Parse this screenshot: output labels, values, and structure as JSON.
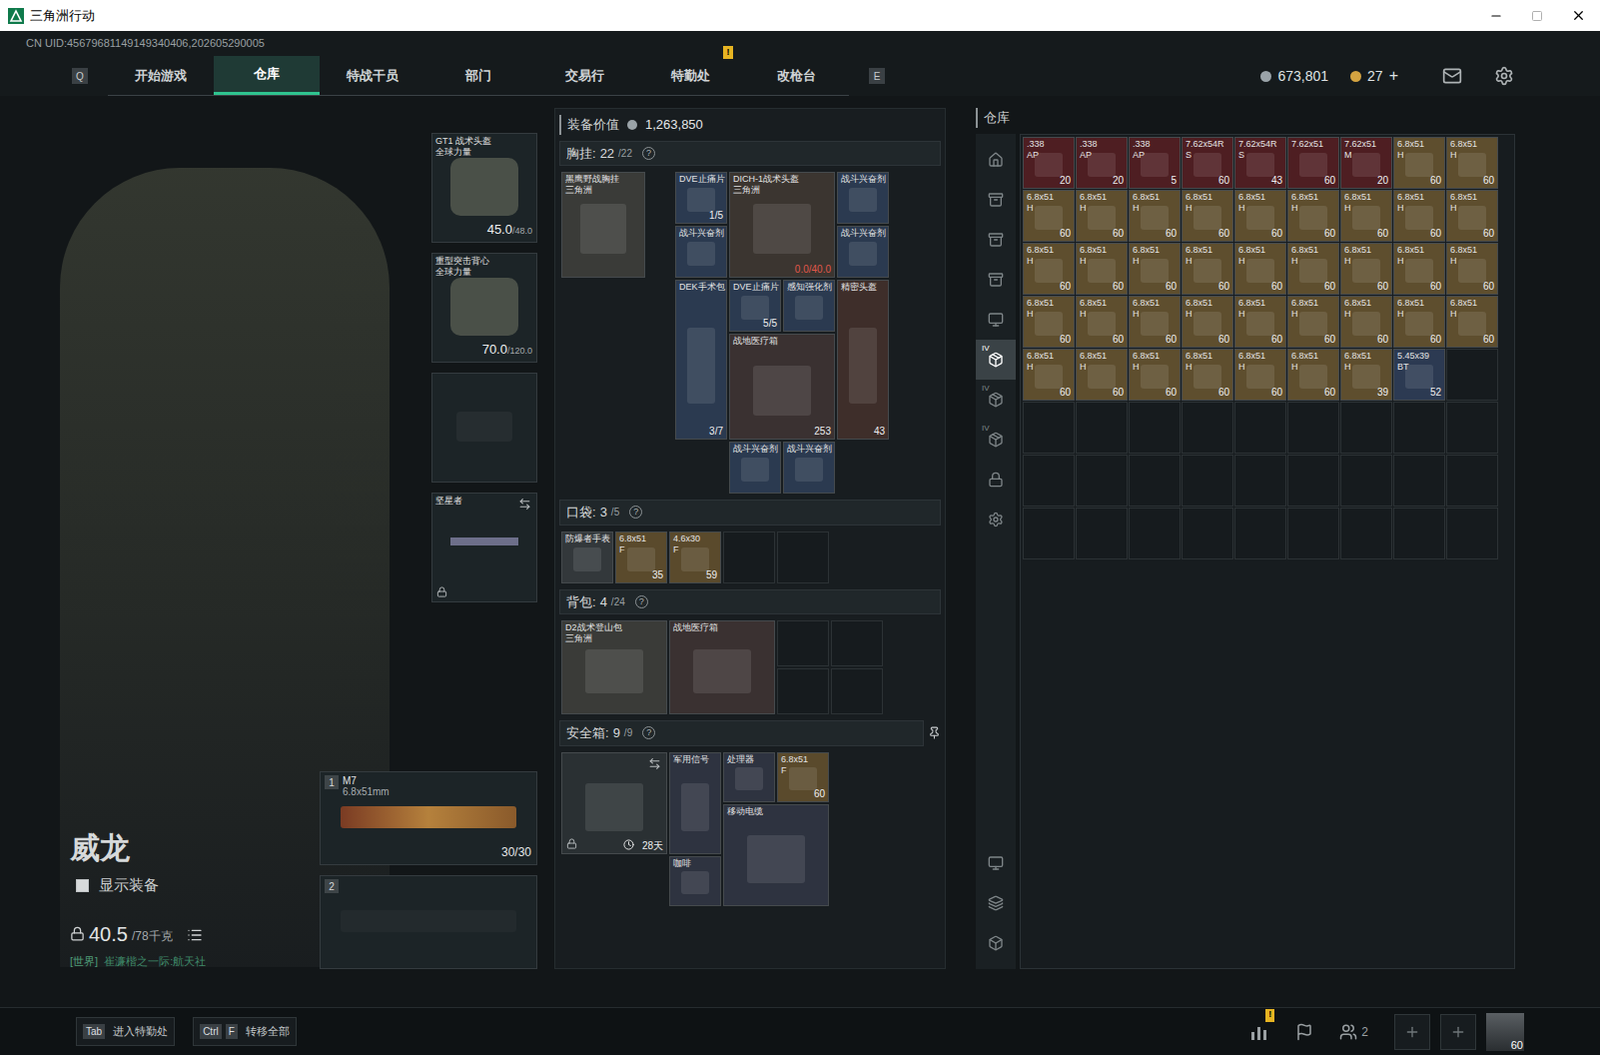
{
  "window": {
    "title": "三角洲行动"
  },
  "uid": "CN UID:45679681149149340406,202605290005",
  "nav": {
    "prev_key": "Q",
    "next_key": "E",
    "alert_badge": "!",
    "tabs": [
      {
        "label": "开始游戏",
        "selected": false,
        "alert": false
      },
      {
        "label": "仓库",
        "selected": true,
        "alert": false
      },
      {
        "label": "特战干员",
        "selected": false,
        "alert": false
      },
      {
        "label": "部门",
        "selected": false,
        "alert": false
      },
      {
        "label": "交易行",
        "selected": false,
        "alert": false
      },
      {
        "label": "特勤处",
        "selected": false,
        "alert": true
      },
      {
        "label": "改枪台",
        "selected": false,
        "alert": false
      }
    ]
  },
  "currency": {
    "coins": "673,801",
    "tokens": "27",
    "add": "+"
  },
  "operator": {
    "name": "威龙",
    "show_equipment": {
      "label": "显示装备",
      "checked": false
    },
    "weight": "40.5",
    "weight_max": "/78千克",
    "chat": {
      "channel": "[世界]",
      "text": "崔濂楷之一际:航天社"
    }
  },
  "gear_slots": [
    {
      "kind": "helmet",
      "name": "GT1 战术头盔",
      "sub": "全球力量",
      "value": "45.0",
      "max": "/48.0",
      "locked": false
    },
    {
      "kind": "armor",
      "name": "重型突击背心",
      "sub": "全球力量",
      "value": "70.0",
      "max": "/120.0",
      "locked": false
    },
    {
      "kind": "empty",
      "name": "",
      "sub": "",
      "value": "",
      "max": "",
      "locked": false
    },
    {
      "kind": "melee",
      "name": "坚星者",
      "sub": "",
      "value": "",
      "max": "",
      "locked": true
    }
  ],
  "weapons": [
    {
      "slot": "1",
      "name": "M7",
      "caliber": "6.8x51mm",
      "ammo": "30/30",
      "empty": false
    },
    {
      "slot": "2",
      "name": "",
      "caliber": "",
      "ammo": "",
      "empty": true
    }
  ],
  "loadout": {
    "value_label": "装备价值",
    "value": "1,263,850",
    "chest": {
      "label": "胸挂:",
      "count": "22",
      "capacity": "/22",
      "help": "?",
      "items": [
        {
          "name": "黑鹰野战胸挂",
          "sub": "三角洲",
          "value": "",
          "broken": false,
          "color": "#3a3b38"
        },
        {
          "name": "DVE止痛片",
          "sub": "",
          "value": "1/5",
          "broken": false,
          "color": "#2b3a50"
        },
        {
          "name": "DICH-1战术头盔",
          "sub": "三角洲",
          "value": "0.0/40.0",
          "broken": true,
          "color": "#3b3530"
        },
        {
          "name": "战斗兴奋剂",
          "sub": "",
          "value": "",
          "broken": false,
          "color": "#2b3a50"
        },
        {
          "name": "战斗兴奋剂",
          "sub": "",
          "value": "",
          "broken": false,
          "color": "#2b3a50"
        },
        {
          "name": "战斗兴奋剂",
          "sub": "",
          "value": "",
          "broken": false,
          "color": "#2b3a50"
        },
        {
          "name": "DEK手术包",
          "sub": "",
          "value": "3/7",
          "broken": false,
          "color": "#2b3a50"
        },
        {
          "name": "DVE止痛片",
          "sub": "",
          "value": "5/5",
          "broken": false,
          "color": "#2b3a50"
        },
        {
          "name": "感知强化剂",
          "sub": "",
          "value": "",
          "broken": false,
          "color": "#2b3a50"
        },
        {
          "name": "精密头盔",
          "sub": "",
          "value": "43",
          "broken": false,
          "color": "#3e2e2a"
        },
        {
          "name": "战地医疗箱",
          "sub": "",
          "value": "253",
          "broken": false,
          "color": "#3a3131"
        },
        {
          "name": "战斗兴奋剂",
          "sub": "",
          "value": "",
          "broken": false,
          "color": "#2b3a50"
        },
        {
          "name": "战斗兴奋剂",
          "sub": "",
          "value": "",
          "broken": false,
          "color": "#2b3a50"
        }
      ]
    },
    "pockets": {
      "label": "口袋:",
      "count": "3",
      "capacity": "/5",
      "help": "?",
      "empty_slots": 2,
      "items": [
        {
          "name": "防爆者手表",
          "sub": "",
          "value": "",
          "broken": false,
          "color": "#33383b"
        },
        {
          "name": "6.8x51",
          "sub": "F",
          "value": "35",
          "broken": false,
          "color": "#5a4a2c"
        },
        {
          "name": "4.6x30",
          "sub": "F",
          "value": "59",
          "broken": false,
          "color": "#5a4a2c"
        }
      ]
    },
    "backpack": {
      "label": "背包:",
      "count": "4",
      "capacity": "/24",
      "help": "?",
      "empty_slots": 4,
      "items": [
        {
          "name": "D2战术登山包",
          "sub": "三角洲",
          "value": "",
          "broken": false,
          "color": "#3a3b38"
        },
        {
          "name": "战地医疗箱",
          "sub": "",
          "value": "",
          "broken": false,
          "color": "#3a3131"
        }
      ]
    },
    "safe": {
      "label": "安全箱:",
      "count": "9",
      "capacity": "/9",
      "help": "?",
      "items": [
        {
          "name": "",
          "sub": "",
          "value": "28天",
          "broken": false,
          "color": "#2a3033"
        },
        {
          "name": "军用信号",
          "sub": "",
          "value": "",
          "broken": false,
          "color": "#2e3340"
        },
        {
          "name": "处理器",
          "sub": "",
          "value": "",
          "broken": false,
          "color": "#2e3340"
        },
        {
          "name": "6.8x51",
          "sub": "F",
          "value": "60",
          "broken": false,
          "color": "#5a4a2c"
        },
        {
          "name": "移动电缆",
          "sub": "",
          "value": "",
          "broken": false,
          "color": "#2e3340"
        },
        {
          "name": "咖啡",
          "sub": "",
          "value": "",
          "broken": false,
          "color": "#2e3340"
        }
      ]
    }
  },
  "warehouse": {
    "label": "仓库",
    "tabs": [
      {
        "badge": "",
        "selected": false
      },
      {
        "badge": "",
        "selected": false
      },
      {
        "badge": "",
        "selected": false
      },
      {
        "badge": "",
        "selected": false
      },
      {
        "badge": "",
        "selected": false
      },
      {
        "badge": "IV",
        "selected": true
      },
      {
        "badge": "IV",
        "selected": false
      },
      {
        "badge": "IV",
        "selected": false
      },
      {
        "badge": "",
        "selected": false
      },
      {
        "badge": "",
        "selected": false
      }
    ],
    "empty_cells": 28,
    "items": [
      {
        "name": ".338",
        "sub": "AP",
        "value": "20",
        "color": "#4e1e22"
      },
      {
        "name": ".338",
        "sub": "AP",
        "value": "20",
        "color": "#4e1e22"
      },
      {
        "name": ".338",
        "sub": "AP",
        "value": "5",
        "color": "#4e1e22"
      },
      {
        "name": "7.62x54R",
        "sub": "S",
        "value": "60",
        "color": "#4e1e22"
      },
      {
        "name": "7.62x54R",
        "sub": "S",
        "value": "43",
        "color": "#4e1e22"
      },
      {
        "name": "7.62x51",
        "sub": "",
        "value": "60",
        "color": "#4e1e22"
      },
      {
        "name": "7.62x51",
        "sub": "M",
        "value": "20",
        "color": "#4e1e22"
      },
      {
        "name": "6.8x51",
        "sub": "H",
        "value": "60",
        "color": "#5e4e2e"
      },
      {
        "name": "6.8x51",
        "sub": "H",
        "value": "60",
        "color": "#5e4e2e"
      },
      {
        "name": "6.8x51",
        "sub": "H",
        "value": "60",
        "color": "#5e4e2e"
      },
      {
        "name": "6.8x51",
        "sub": "H",
        "value": "60",
        "color": "#5e4e2e"
      },
      {
        "name": "6.8x51",
        "sub": "H",
        "value": "60",
        "color": "#5e4e2e"
      },
      {
        "name": "6.8x51",
        "sub": "H",
        "value": "60",
        "color": "#5e4e2e"
      },
      {
        "name": "6.8x51",
        "sub": "H",
        "value": "60",
        "color": "#5e4e2e"
      },
      {
        "name": "6.8x51",
        "sub": "H",
        "value": "60",
        "color": "#5e4e2e"
      },
      {
        "name": "6.8x51",
        "sub": "H",
        "value": "60",
        "color": "#5e4e2e"
      },
      {
        "name": "6.8x51",
        "sub": "H",
        "value": "60",
        "color": "#5e4e2e"
      },
      {
        "name": "6.8x51",
        "sub": "H",
        "value": "60",
        "color": "#5e4e2e"
      },
      {
        "name": "6.8x51",
        "sub": "H",
        "value": "60",
        "color": "#5e4e2e"
      },
      {
        "name": "6.8x51",
        "sub": "H",
        "value": "60",
        "color": "#5e4e2e"
      },
      {
        "name": "6.8x51",
        "sub": "H",
        "value": "60",
        "color": "#5e4e2e"
      },
      {
        "name": "6.8x51",
        "sub": "H",
        "value": "60",
        "color": "#5e4e2e"
      },
      {
        "name": "6.8x51",
        "sub": "H",
        "value": "60",
        "color": "#5e4e2e"
      },
      {
        "name": "6.8x51",
        "sub": "H",
        "value": "60",
        "color": "#5e4e2e"
      },
      {
        "name": "6.8x51",
        "sub": "H",
        "value": "60",
        "color": "#5e4e2e"
      },
      {
        "name": "6.8x51",
        "sub": "H",
        "value": "60",
        "color": "#5e4e2e"
      },
      {
        "name": "6.8x51",
        "sub": "H",
        "value": "60",
        "color": "#5e4e2e"
      },
      {
        "name": "6.8x51",
        "sub": "H",
        "value": "60",
        "color": "#5e4e2e"
      },
      {
        "name": "6.8x51",
        "sub": "H",
        "value": "60",
        "color": "#5e4e2e"
      },
      {
        "name": "6.8x51",
        "sub": "H",
        "value": "60",
        "color": "#5e4e2e"
      },
      {
        "name": "6.8x51",
        "sub": "H",
        "value": "60",
        "color": "#5e4e2e"
      },
      {
        "name": "6.8x51",
        "sub": "H",
        "value": "60",
        "color": "#5e4e2e"
      },
      {
        "name": "6.8x51",
        "sub": "H",
        "value": "60",
        "color": "#5e4e2e"
      },
      {
        "name": "6.8x51",
        "sub": "H",
        "value": "60",
        "color": "#5e4e2e"
      },
      {
        "name": "6.8x51",
        "sub": "H",
        "value": "60",
        "color": "#5e4e2e"
      },
      {
        "name": "6.8x51",
        "sub": "H",
        "value": "60",
        "color": "#5e4e2e"
      },
      {
        "name": "6.8x51",
        "sub": "H",
        "value": "60",
        "color": "#5e4e2e"
      },
      {
        "name": "6.8x51",
        "sub": "H",
        "value": "60",
        "color": "#5e4e2e"
      },
      {
        "name": "6.8x51",
        "sub": "H",
        "value": "60",
        "color": "#5e4e2e"
      },
      {
        "name": "6.8x51",
        "sub": "H",
        "value": "60",
        "color": "#5e4e2e"
      },
      {
        "name": "6.8x51",
        "sub": "H",
        "value": "60",
        "color": "#5e4e2e"
      },
      {
        "name": "6.8x51",
        "sub": "H",
        "value": "60",
        "color": "#5e4e2e"
      },
      {
        "name": "6.8x51",
        "sub": "H",
        "value": "39",
        "color": "#5e4e2e"
      },
      {
        "name": "5.45x39",
        "sub": "BT",
        "value": "52",
        "color": "#2c3a52"
      }
    ]
  },
  "bottom": {
    "hints": [
      {
        "keys": [
          "Tab"
        ],
        "label": "进入特勤处"
      },
      {
        "keys": [
          "Ctrl",
          "F"
        ],
        "label": "转移全部"
      }
    ],
    "alert": "!",
    "friends": "2",
    "level": "60"
  }
}
